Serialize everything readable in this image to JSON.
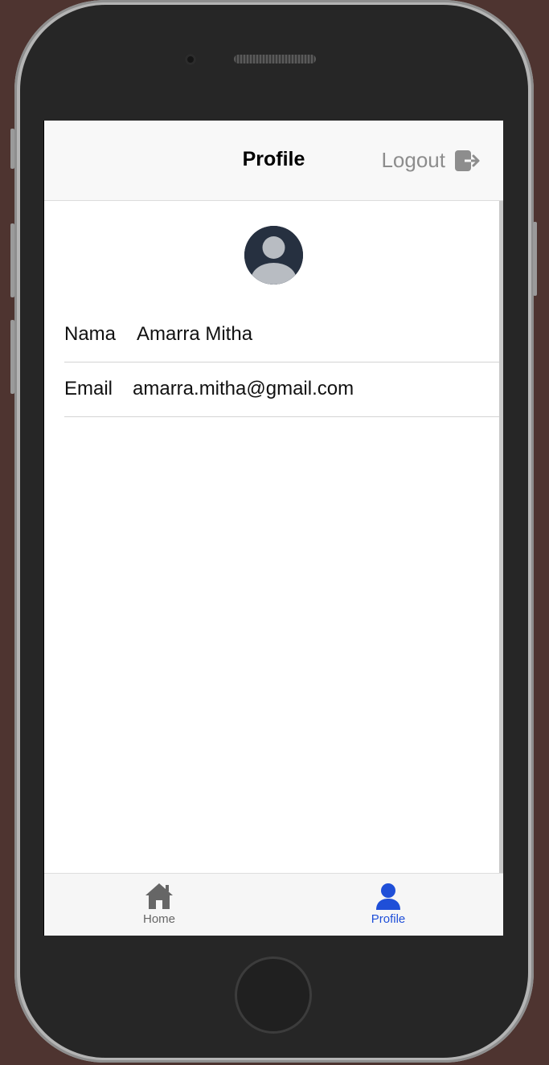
{
  "header": {
    "title": "Profile",
    "logout_label": "Logout",
    "logout_icon": "logout-icon"
  },
  "profile": {
    "avatar_icon": "user-avatar-icon",
    "fields": [
      {
        "label": "Nama",
        "value": "Amarra Mitha"
      },
      {
        "label": "Email",
        "value": "amarra.mitha@gmail.com"
      }
    ]
  },
  "tabs": [
    {
      "label": "Home",
      "icon": "home-icon",
      "active": false
    },
    {
      "label": "Profile",
      "icon": "person-icon",
      "active": true
    }
  ],
  "colors": {
    "active_tab": "#1f4fd8",
    "inactive_tab": "#666666",
    "logout_text": "#8d8d8d",
    "header_bg": "#f8f8f8"
  }
}
